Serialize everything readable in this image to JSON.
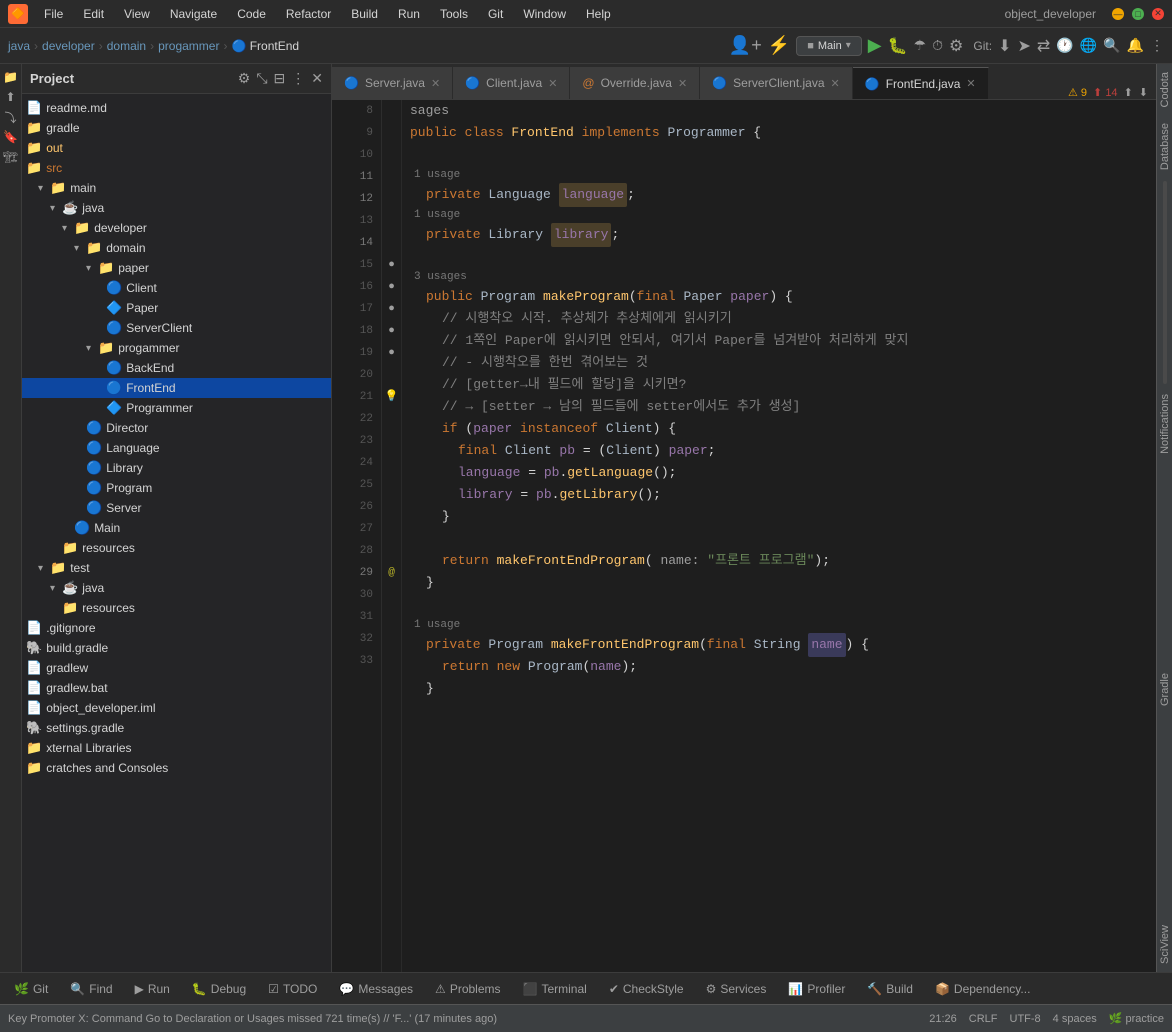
{
  "app": {
    "title": "object_developer",
    "icon": "🔶"
  },
  "menu": {
    "items": [
      "File",
      "Edit",
      "View",
      "Navigate",
      "Code",
      "Refactor",
      "Build",
      "Run",
      "Tools",
      "Git",
      "Window",
      "Help"
    ]
  },
  "window": {
    "minimize": "—",
    "maximize": "□",
    "close": "✕"
  },
  "nav": {
    "breadcrumb": [
      "java",
      "developer",
      "domain",
      "progammer",
      "FrontEnd"
    ],
    "run_config": "Main",
    "git_label": "Git:"
  },
  "sidebar": {
    "title": "Project",
    "tree": [
      {
        "id": "readme",
        "label": "readme.md",
        "icon": "📄",
        "indent": 0,
        "type": "file"
      },
      {
        "id": "gradle",
        "label": "gradle",
        "icon": "📁",
        "indent": 0,
        "type": "folder"
      },
      {
        "id": "out",
        "label": "out",
        "icon": "📁",
        "indent": 0,
        "type": "folder"
      },
      {
        "id": "src",
        "label": "src",
        "icon": "📁",
        "indent": 0,
        "type": "folder"
      },
      {
        "id": "main",
        "label": "main",
        "icon": "📁",
        "indent": 1,
        "type": "folder",
        "expanded": true
      },
      {
        "id": "java",
        "label": "java",
        "icon": "☕",
        "indent": 2,
        "type": "folder",
        "expanded": true
      },
      {
        "id": "developer",
        "label": "developer",
        "icon": "📁",
        "indent": 3,
        "type": "folder",
        "expanded": true
      },
      {
        "id": "domain",
        "label": "domain",
        "icon": "📁",
        "indent": 4,
        "type": "folder",
        "expanded": true
      },
      {
        "id": "paper",
        "label": "paper",
        "icon": "📁",
        "indent": 5,
        "type": "folder",
        "expanded": true
      },
      {
        "id": "Client",
        "label": "Client",
        "icon": "🔵",
        "indent": 6,
        "type": "class"
      },
      {
        "id": "Paper",
        "label": "Paper",
        "icon": "🔷",
        "indent": 6,
        "type": "class"
      },
      {
        "id": "ServerClient",
        "label": "ServerClient",
        "icon": "🔵",
        "indent": 6,
        "type": "class"
      },
      {
        "id": "progammer",
        "label": "progammer",
        "icon": "📁",
        "indent": 5,
        "type": "folder",
        "expanded": true
      },
      {
        "id": "BackEnd",
        "label": "BackEnd",
        "icon": "🔵",
        "indent": 6,
        "type": "class"
      },
      {
        "id": "FrontEnd",
        "label": "FrontEnd",
        "icon": "🔵",
        "indent": 6,
        "type": "class",
        "selected": true
      },
      {
        "id": "Programmer",
        "label": "Programmer",
        "icon": "🔷",
        "indent": 6,
        "type": "class"
      },
      {
        "id": "Director",
        "label": "Director",
        "icon": "🔵",
        "indent": 5,
        "type": "class"
      },
      {
        "id": "Language",
        "label": "Language",
        "icon": "🔵",
        "indent": 5,
        "type": "class"
      },
      {
        "id": "Library",
        "label": "Library",
        "icon": "🔵",
        "indent": 5,
        "type": "class"
      },
      {
        "id": "Program",
        "label": "Program",
        "icon": "🔵",
        "indent": 5,
        "type": "class"
      },
      {
        "id": "Server",
        "label": "Server",
        "icon": "🔵",
        "indent": 5,
        "type": "class"
      },
      {
        "id": "Main",
        "label": "Main",
        "icon": "🔵",
        "indent": 4,
        "type": "class"
      },
      {
        "id": "resources",
        "label": "resources",
        "icon": "📁",
        "indent": 3,
        "type": "folder"
      },
      {
        "id": "test",
        "label": "test",
        "icon": "📁",
        "indent": 1,
        "type": "folder",
        "expanded": true
      },
      {
        "id": "test-java",
        "label": "java",
        "icon": "☕",
        "indent": 2,
        "type": "folder",
        "expanded": true
      },
      {
        "id": "test-resources",
        "label": "resources",
        "icon": "📁",
        "indent": 3,
        "type": "folder"
      },
      {
        "id": "gitignore",
        "label": ".gitignore",
        "icon": "📄",
        "indent": 0,
        "type": "file"
      },
      {
        "id": "build-gradle",
        "label": "build.gradle",
        "icon": "🐘",
        "indent": 0,
        "type": "file"
      },
      {
        "id": "gradlew",
        "label": "gradlew",
        "icon": "📄",
        "indent": 0,
        "type": "file"
      },
      {
        "id": "gradlew-bat",
        "label": "gradlew.bat",
        "icon": "📄",
        "indent": 0,
        "type": "file"
      },
      {
        "id": "object-dev-iml",
        "label": "object_developer.iml",
        "icon": "📄",
        "indent": 0,
        "type": "file"
      },
      {
        "id": "settings-gradle",
        "label": "settings.gradle",
        "icon": "🐘",
        "indent": 0,
        "type": "file"
      },
      {
        "id": "external-libs",
        "label": "xternal Libraries",
        "icon": "📁",
        "indent": 0,
        "type": "folder"
      },
      {
        "id": "scratches",
        "label": "cratches and Consoles",
        "icon": "📁",
        "indent": 0,
        "type": "folder"
      }
    ]
  },
  "tabs": [
    {
      "id": "server",
      "label": "Server.java",
      "icon": "🔵",
      "active": false
    },
    {
      "id": "client",
      "label": "Client.java",
      "icon": "🔵",
      "active": false
    },
    {
      "id": "override",
      "label": "Override.java",
      "icon": "🔷",
      "active": false
    },
    {
      "id": "serverclient",
      "label": "ServerClient.java",
      "icon": "🔵",
      "active": false
    },
    {
      "id": "frontend",
      "label": "FrontEnd.java",
      "icon": "🔵",
      "active": true
    }
  ],
  "warnings": {
    "warning_count": "9",
    "error_count": "14"
  },
  "code_lines": [
    {
      "num": "8",
      "content": "sages",
      "gutter": ""
    },
    {
      "num": "9",
      "content": "public class FrontEnd implements Programmer {",
      "gutter": ""
    },
    {
      "num": "10",
      "content": "",
      "gutter": ""
    },
    {
      "num": "11",
      "content": "    private Language language;",
      "gutter": "",
      "usage": "1 usage"
    },
    {
      "num": "12",
      "content": "    private Library library;",
      "gutter": "",
      "usage": "1 usage"
    },
    {
      "num": "13",
      "content": "",
      "gutter": ""
    },
    {
      "num": "14",
      "content": "    public Program makeProgram(final Paper paper) {",
      "gutter": "",
      "usage": "3 usages"
    },
    {
      "num": "15",
      "content": "        // 시행착오 시작. 추상체가 추상체에게 읽시키기",
      "gutter": "●"
    },
    {
      "num": "16",
      "content": "        // 1쪽인 Paper에 읽시키면 안되서, 여기서 Paper를 넘겨받아 처리하게 맞지",
      "gutter": "●"
    },
    {
      "num": "17",
      "content": "        // - 시행착오를 한번 겪어보는 것",
      "gutter": "●"
    },
    {
      "num": "18",
      "content": "        // [getter→내 필드에 할당]을 시키면?",
      "gutter": "●"
    },
    {
      "num": "19",
      "content": "        // → [setter → 남의 필드들에 setter에서도 추가 생성]",
      "gutter": "●"
    },
    {
      "num": "20",
      "content": "        if (paper instanceof Client) {",
      "gutter": ""
    },
    {
      "num": "21",
      "content": "            final Client pb = (Client) paper;",
      "gutter": "💡"
    },
    {
      "num": "22",
      "content": "            language = pb.getLanguage();",
      "gutter": ""
    },
    {
      "num": "23",
      "content": "            library = pb.getLibrary();",
      "gutter": ""
    },
    {
      "num": "24",
      "content": "        }",
      "gutter": ""
    },
    {
      "num": "25",
      "content": "",
      "gutter": ""
    },
    {
      "num": "26",
      "content": "        return makeFrontEndProgram( name: \"프론트 프로그램\");",
      "gutter": ""
    },
    {
      "num": "27",
      "content": "    }",
      "gutter": ""
    },
    {
      "num": "28",
      "content": "",
      "gutter": ""
    },
    {
      "num": "29",
      "content": "    private Program makeFrontEndProgram(final String name) {",
      "gutter": "@",
      "usage": "1 usage"
    },
    {
      "num": "30",
      "content": "        return new Program(name);",
      "gutter": ""
    },
    {
      "num": "31",
      "content": "    }",
      "gutter": ""
    },
    {
      "num": "32",
      "content": "",
      "gutter": ""
    },
    {
      "num": "33",
      "content": "",
      "gutter": ""
    }
  ],
  "right_side_labels": [
    "Codota",
    "Database",
    "Notifications",
    "Gradle",
    "SciView"
  ],
  "bottom_tabs": [
    {
      "id": "git",
      "label": "Git",
      "icon": "🌿",
      "active": false
    },
    {
      "id": "find",
      "label": "Find",
      "icon": "🔍",
      "active": false
    },
    {
      "id": "run",
      "label": "Run",
      "icon": "▶",
      "active": false
    },
    {
      "id": "debug",
      "label": "Debug",
      "icon": "🐛",
      "active": false
    },
    {
      "id": "todo",
      "label": "TODO",
      "icon": "☑",
      "active": false
    },
    {
      "id": "messages",
      "label": "Messages",
      "icon": "💬",
      "active": false
    },
    {
      "id": "problems",
      "label": "Problems",
      "icon": "⚠",
      "active": false
    },
    {
      "id": "terminal",
      "label": "Terminal",
      "icon": "⬛",
      "active": false
    },
    {
      "id": "checkstyle",
      "label": "CheckStyle",
      "icon": "✔",
      "active": false
    },
    {
      "id": "services",
      "label": "Services",
      "icon": "⚙",
      "active": false
    },
    {
      "id": "profiler",
      "label": "Profiler",
      "icon": "📊",
      "active": false
    },
    {
      "id": "build",
      "label": "Build",
      "icon": "🔨",
      "active": false
    },
    {
      "id": "dependency",
      "label": "Dependency...",
      "icon": "📦",
      "active": false
    }
  ],
  "status_bar": {
    "message": "Key Promoter X: Command Go to Declaration or Usages missed 721 time(s) // 'F...' (17 minutes ago)",
    "line_col": "21:26",
    "line_ending": "CRLF",
    "encoding": "UTF-8",
    "indent": "4 spaces",
    "branch": "practice"
  }
}
